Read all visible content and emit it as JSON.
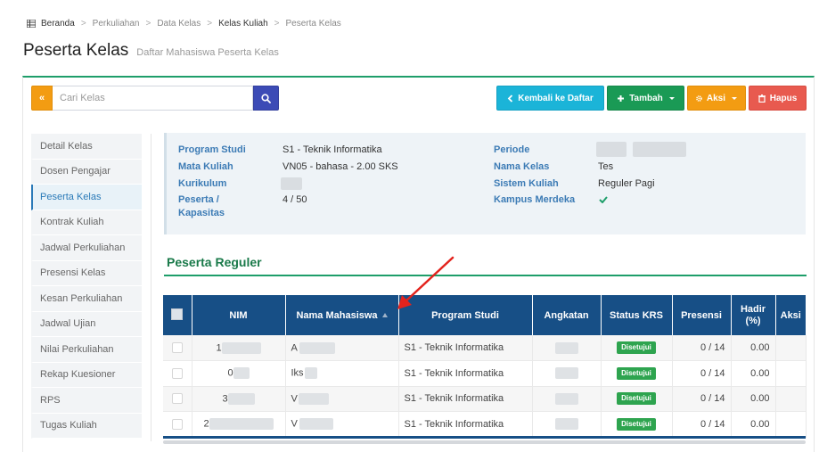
{
  "breadcrumb": {
    "items": [
      {
        "label": "Beranda",
        "active": false
      },
      {
        "label": "Perkuliahan",
        "active": false
      },
      {
        "label": "Data Kelas",
        "active": false
      },
      {
        "label": "Kelas Kuliah",
        "active": true
      },
      {
        "label": "Peserta Kelas",
        "active": false
      }
    ],
    "separator": ">"
  },
  "header": {
    "title": "Peserta Kelas",
    "subtitle": "Daftar Mahasiswa Peserta Kelas"
  },
  "toolbar": {
    "toggle_label": "«",
    "search_placeholder": "Cari Kelas",
    "back_label": "Kembali ke Daftar",
    "add_label": "Tambah",
    "action_label": "Aksi",
    "delete_label": "Hapus"
  },
  "sidebar": {
    "items": [
      {
        "label": "Detail Kelas",
        "active": false
      },
      {
        "label": "Dosen Pengajar",
        "active": false
      },
      {
        "label": "Peserta Kelas",
        "active": true
      },
      {
        "label": "Kontrak Kuliah",
        "active": false
      },
      {
        "label": "Jadwal Perkuliahan",
        "active": false
      },
      {
        "label": "Presensi Kelas",
        "active": false
      },
      {
        "label": "Kesan Perkuliahan",
        "active": false
      },
      {
        "label": "Jadwal Ujian",
        "active": false
      },
      {
        "label": "Nilai Perkuliahan",
        "active": false
      },
      {
        "label": "Rekap Kuesioner",
        "active": false
      },
      {
        "label": "RPS",
        "active": false
      },
      {
        "label": "Tugas Kuliah",
        "active": false
      }
    ]
  },
  "info": {
    "program_studi_label": "Program Studi",
    "program_studi_value": "S1 - Teknik Informatika",
    "mata_kuliah_label": "Mata Kuliah",
    "mata_kuliah_value": "VN05 - bahasa - 2.00 SKS",
    "kurikulum_label": "Kurikulum",
    "peserta_label_1": "Peserta /",
    "peserta_label_2": "Kapasitas",
    "peserta_value": "4 / 50",
    "periode_label": "Periode",
    "nama_kelas_label": "Nama Kelas",
    "nama_kelas_value": "Tes",
    "sistem_kuliah_label": "Sistem Kuliah",
    "sistem_kuliah_value": "Reguler Pagi",
    "kampus_merdeka_label": "Kampus Merdeka"
  },
  "section": {
    "title": "Peserta Reguler"
  },
  "table": {
    "headers": {
      "nim": "NIM",
      "nama": "Nama Mahasiswa",
      "prodi": "Program Studi",
      "angkatan": "Angkatan",
      "status": "Status KRS",
      "presensi": "Presensi",
      "hadir_1": "Hadir",
      "hadir_2": "(%)",
      "aksi": "Aksi"
    },
    "rows": [
      {
        "nim_prefix": "1",
        "nama_prefix": "A",
        "prodi": "S1 - Teknik Informatika",
        "status": "Disetujui",
        "presensi": "0 / 14",
        "hadir": "0.00"
      },
      {
        "nim_prefix": "0",
        "nama_prefix": "Iks",
        "prodi": "S1 - Teknik Informatika",
        "status": "Disetujui",
        "presensi": "0 / 14",
        "hadir": "0.00"
      },
      {
        "nim_prefix": "3",
        "nama_prefix": "V",
        "prodi": "S1 - Teknik Informatika",
        "status": "Disetujui",
        "presensi": "0 / 14",
        "hadir": "0.00"
      },
      {
        "nim_prefix": "2",
        "nama_prefix": "V",
        "prodi": "S1 - Teknik Informatika",
        "status": "Disetujui",
        "presensi": "0 / 14",
        "hadir": "0.00"
      }
    ]
  },
  "colors": {
    "accent_green": "#1e9e6a",
    "table_header": "#174f86",
    "label_blue": "#3c7bb5",
    "badge_green": "#2ea44f",
    "annotation_red": "#e3231d"
  },
  "icons": {
    "home": "grid-icon",
    "search": "search-icon",
    "back": "chevron-left-icon",
    "add": "plus-icon",
    "action": "gear-icon",
    "delete": "trash-icon",
    "check": "check-icon",
    "sort": "sort-asc-icon",
    "annotation": "red-arrow-icon"
  }
}
